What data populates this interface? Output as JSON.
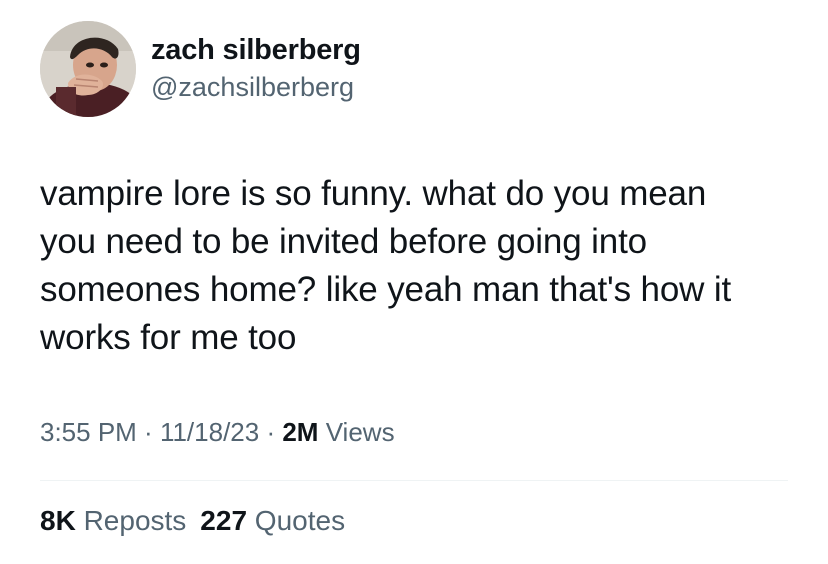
{
  "tweet": {
    "author": {
      "display_name": "zach silberberg",
      "handle": "@zachsilberberg",
      "avatar_icon": "profile-photo"
    },
    "text_lines": [
      "vampire lore is so funny. what do you mean",
      "you need to be invited before going into",
      "someones home? like yeah man that's how it",
      "works for me too"
    ],
    "meta": {
      "time": "3:55 PM",
      "separator": " · ",
      "date": "11/18/23",
      "views_count": "2M",
      "views_label": "Views"
    },
    "stats": {
      "reposts_count": "8K",
      "reposts_label": "Reposts",
      "quotes_count": "227",
      "quotes_label": "Quotes"
    }
  },
  "colors": {
    "primary_text": "#0f1419",
    "secondary_text": "#536471",
    "divider": "#eff3f4",
    "background": "#ffffff"
  }
}
